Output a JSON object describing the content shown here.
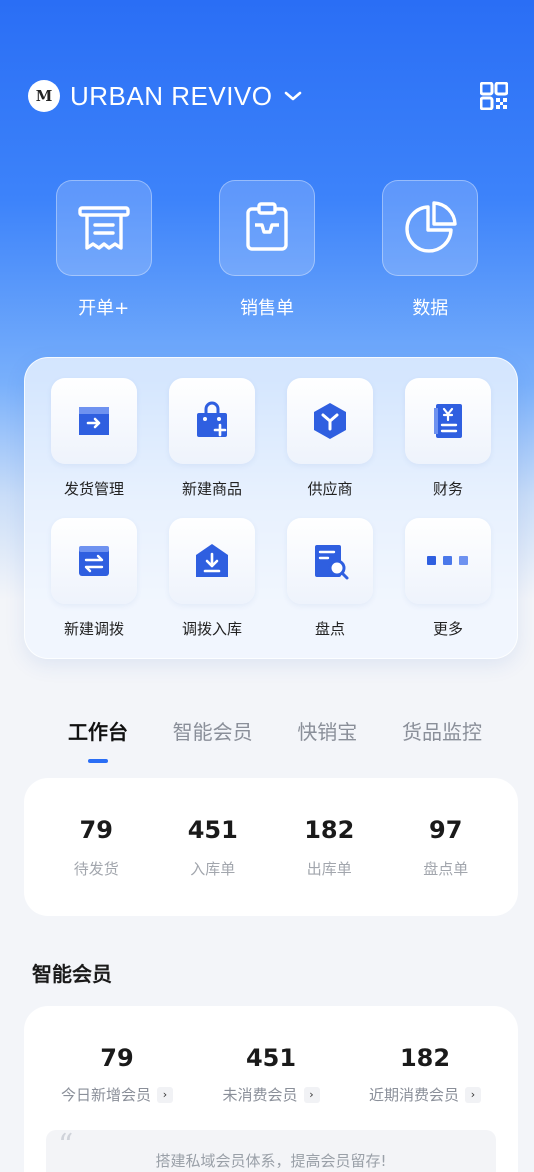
{
  "header": {
    "brand_logo_text": "M",
    "brand_name": "URBAN REVIVO"
  },
  "top_actions": [
    {
      "label": "开单+",
      "icon": "receipt-icon"
    },
    {
      "label": "销售单",
      "icon": "clipboard-icon"
    },
    {
      "label": "数据",
      "icon": "pie-chart-icon"
    }
  ],
  "grid": [
    {
      "label": "发货管理",
      "icon": "shipping-box-icon"
    },
    {
      "label": "新建商品",
      "icon": "shopping-bag-plus-icon"
    },
    {
      "label": "供应商",
      "icon": "supplier-hexagon-icon"
    },
    {
      "label": "财务",
      "icon": "finance-yen-icon"
    },
    {
      "label": "新建调拨",
      "icon": "transfer-icon"
    },
    {
      "label": "调拨入库",
      "icon": "inbound-icon"
    },
    {
      "label": "盘点",
      "icon": "stocktake-search-icon"
    },
    {
      "label": "更多",
      "icon": "more-dots-icon"
    }
  ],
  "tabs": [
    {
      "label": "工作台",
      "active": true
    },
    {
      "label": "智能会员",
      "active": false
    },
    {
      "label": "快销宝",
      "active": false
    },
    {
      "label": "货品监控",
      "active": false
    }
  ],
  "stats": [
    {
      "value": "79",
      "label": "待发货"
    },
    {
      "value": "451",
      "label": "入库单"
    },
    {
      "value": "182",
      "label": "出库单"
    },
    {
      "value": "97",
      "label": "盘点单"
    }
  ],
  "member_section": {
    "title": "智能会员",
    "stats": [
      {
        "value": "79",
        "label": "今日新增会员"
      },
      {
        "value": "451",
        "label": "未消费会员"
      },
      {
        "value": "182",
        "label": "近期消费会员"
      }
    ],
    "quote": "搭建私域会员体系，提高会员留存!"
  },
  "colors": {
    "accent": "#2a6ef5",
    "icon_blue": "#2f5fe0"
  }
}
